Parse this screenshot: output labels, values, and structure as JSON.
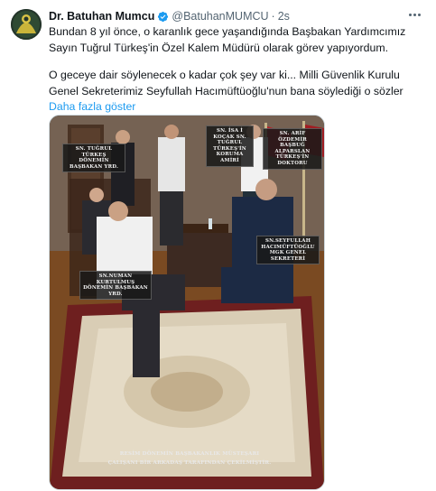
{
  "author": {
    "display_name": "Dr. Batuhan Mumcu",
    "handle": "@BatuhanMUMCU",
    "separator": "·",
    "time": "2s"
  },
  "tweet": {
    "line1": "Bundan 8 yıl önce, o karanlık gece yaşandığında Başbakan Yardımcımız",
    "line2": "Sayın Tuğrul Türkeş'in Özel Kalem Müdürü olarak görev yapıyordum.",
    "line3": "O geceye dair söylenecek o kadar çok şey var ki... Milli Güvenlik Kurulu",
    "line4": "Genel Sekreterimiz Seyfullah Hacımüftüoğlu'nun bana söylediği o sözler",
    "show_more": "Daha fazla göster"
  },
  "photo_captions": {
    "tugrul": "SN. TUĞRUL TÜRKEŞ DÖNEMİN BAŞBAKAN YRD.",
    "koruma": "SN. İSA İ KOÇAK SN. TUĞRUL TÜRKEŞ'İN KORUMA AMİRİ",
    "doktor": "SN. ARİF ÖZDEMİR BAŞBUĞ ALPARSLAN TÜRKEŞ'İN DOKTORU",
    "seyfullah": "SN.SEYFULLAH HACIMÜFTÜOĞLU MGK GENEL SEKRETERİ",
    "numan": "SN.NUMAN KURTULMUŞ DÖNEMİN BAŞBAKAN YRD.",
    "credit_1": "RESİM DÖNEMİN BAŞBAKANLIK MÜSTEŞARI",
    "credit_2": "ÇALIŞANI BİR ARKADAŞ TARAFINDAN ÇEKİLMİŞTİR."
  },
  "colors": {
    "verified": "#1d9bf0",
    "link": "#1d9bf0",
    "muted_text": "#536471"
  },
  "icons": {
    "verified": "verified-badge-icon",
    "more": "more-options-icon"
  }
}
